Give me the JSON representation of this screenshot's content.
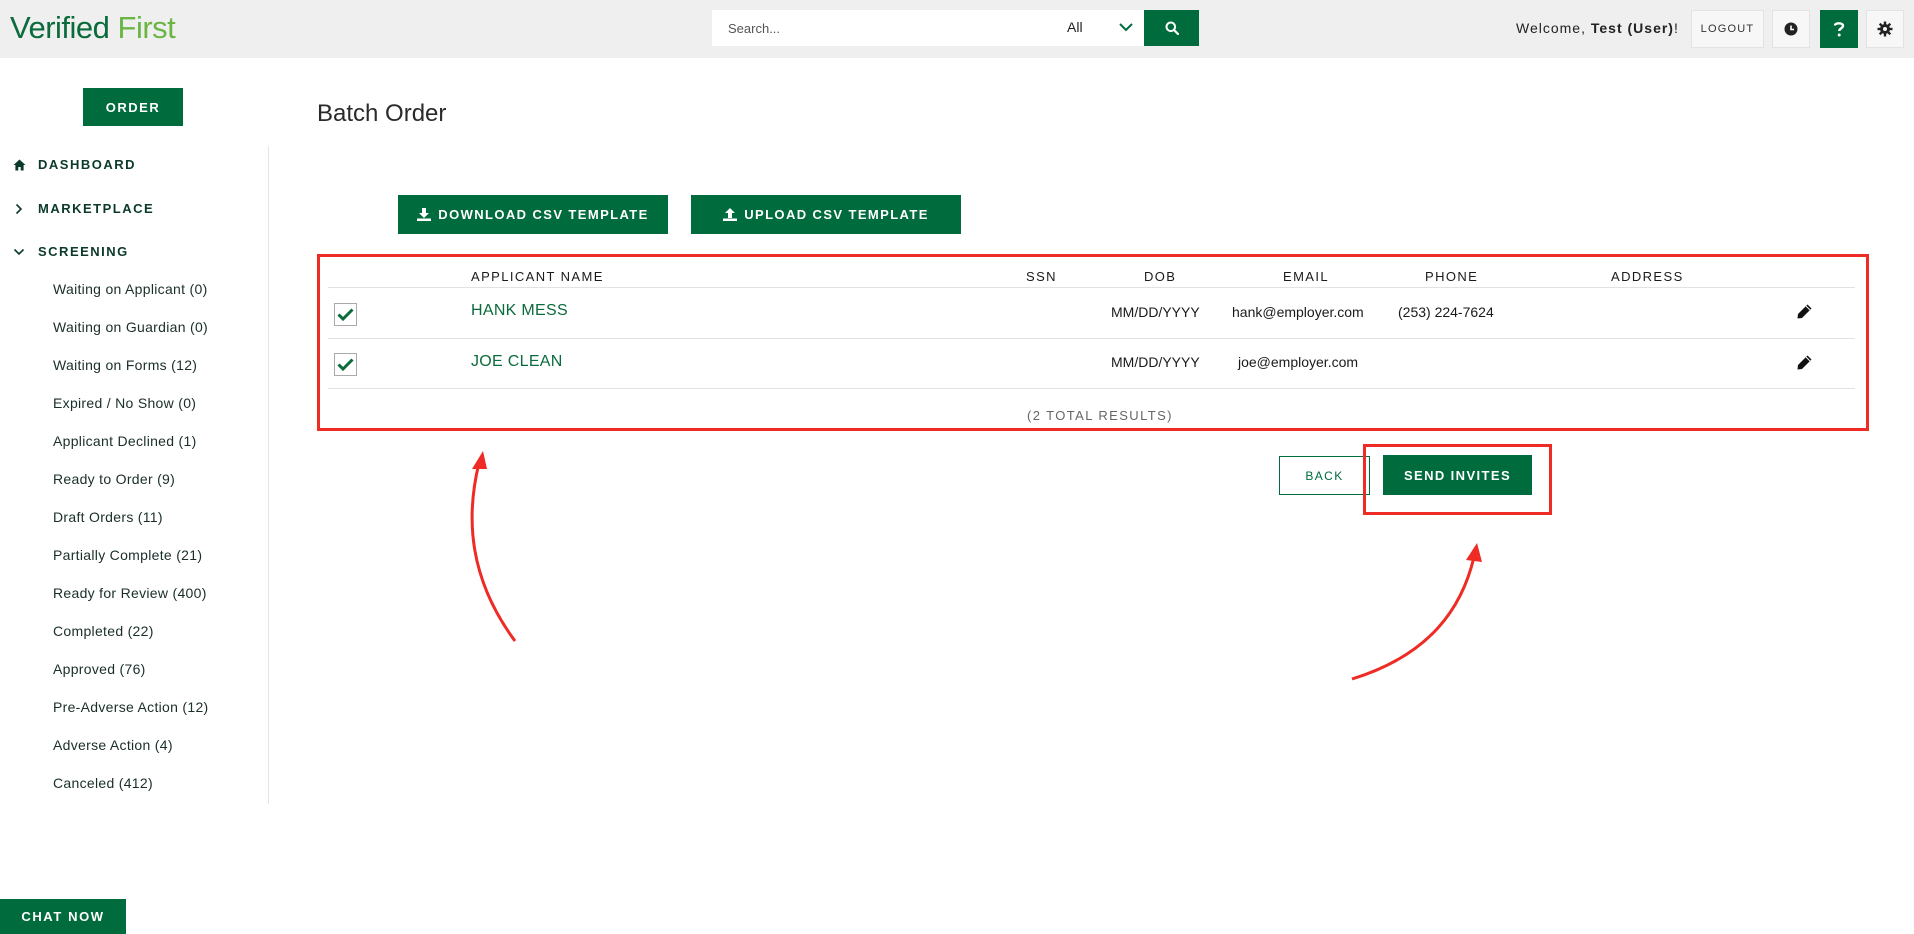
{
  "header": {
    "logo_part1": "Verified",
    "logo_part2": "First",
    "search_placeholder": "Search...",
    "search_scope": "All",
    "welcome_prefix": "Welcome,",
    "welcome_user": "Test (User)",
    "welcome_suffix": "!",
    "logout_label": "LOGOUT"
  },
  "sidebar": {
    "order_label": "ORDER",
    "nav": [
      {
        "label": "DASHBOARD",
        "icon": "home-icon"
      },
      {
        "label": "MARKETPLACE",
        "icon": "chevron-right-icon"
      },
      {
        "label": "SCREENING",
        "icon": "chevron-down-icon"
      }
    ],
    "screening_items": [
      "Waiting on Applicant (0)",
      "Waiting on Guardian (0)",
      "Waiting on Forms (12)",
      "Expired / No Show (0)",
      "Applicant Declined (1)",
      "Ready to Order (9)",
      "Draft Orders (11)",
      "Partially Complete (21)",
      "Ready for Review (400)",
      "Completed (22)",
      "Approved (76)",
      "Pre-Adverse Action (12)",
      "Adverse Action (4)",
      "Canceled (412)"
    ]
  },
  "main": {
    "title": "Batch Order",
    "download_label": "DOWNLOAD CSV TEMPLATE",
    "upload_label": "UPLOAD CSV TEMPLATE",
    "columns": [
      "APPLICANT NAME",
      "SSN",
      "DOB",
      "EMAIL",
      "PHONE",
      "ADDRESS"
    ],
    "rows": [
      {
        "checked": true,
        "name": "HANK MESS",
        "ssn": "",
        "dob": "MM/DD/YYYY",
        "email": "hank@employer.com",
        "phone": "(253) 224-7624",
        "address": ""
      },
      {
        "checked": true,
        "name": "JOE CLEAN",
        "ssn": "",
        "dob": "MM/DD/YYYY",
        "email": "joe@employer.com",
        "phone": "",
        "address": ""
      }
    ],
    "total_results": "(2 TOTAL RESULTS)",
    "back_label": "BACK",
    "send_label": "SEND INVITES"
  },
  "chat_label": "CHAT NOW",
  "colors": {
    "brand_green": "#006b3c",
    "logo_light_green": "#6bb544",
    "annotation_red": "#ee2b24"
  }
}
